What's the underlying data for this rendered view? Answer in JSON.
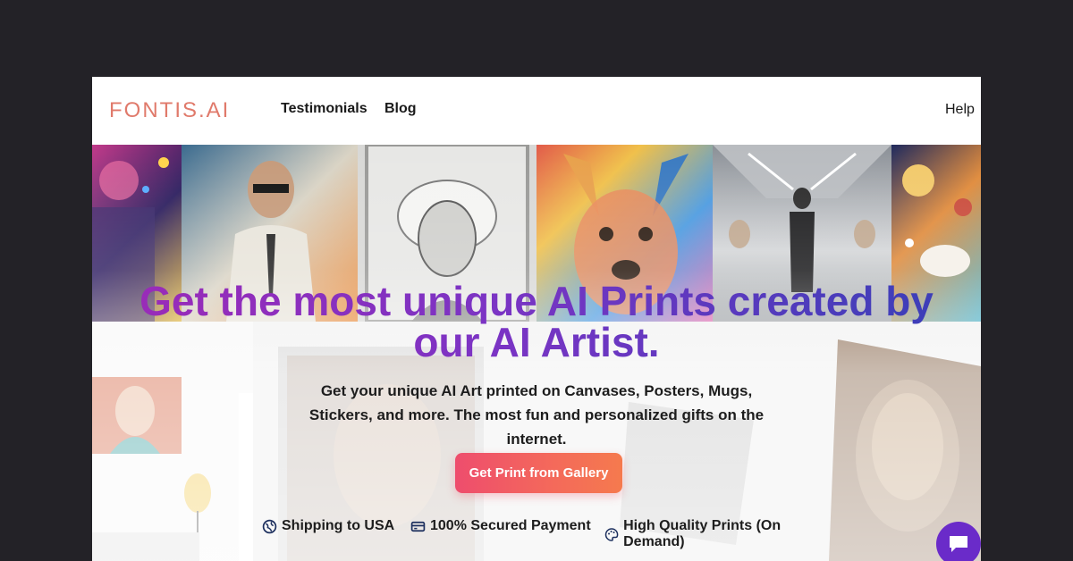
{
  "brand": {
    "logo": "FONTIS.AI"
  },
  "nav": {
    "links": [
      "Testimonials",
      "Blog"
    ],
    "help": "Help"
  },
  "hero": {
    "headline": "Get the most unique AI Prints created by our AI Artist.",
    "subtitle": "Get your unique AI Art printed on Canvases, Posters, Mugs, Stickers, and more. The most fun and personalized gifts on the internet.",
    "cta_label": "Get Print from Gallery"
  },
  "features": [
    {
      "icon": "globe-icon",
      "label": "Shipping to USA"
    },
    {
      "icon": "credit-card-icon",
      "label": "100% Secured Payment"
    },
    {
      "icon": "palette-icon",
      "label": "High Quality Prints (On Demand)"
    }
  ],
  "colors": {
    "page_bg": "#232227",
    "logo": "#e07a6b",
    "cta_start": "#ee4d6d",
    "cta_end": "#f57a4e",
    "headline_start": "#9a2bb8",
    "headline_end": "#3b3fb8",
    "chat_button": "#6a2bc9"
  },
  "chat": {
    "icon": "chat-bubble-icon"
  }
}
